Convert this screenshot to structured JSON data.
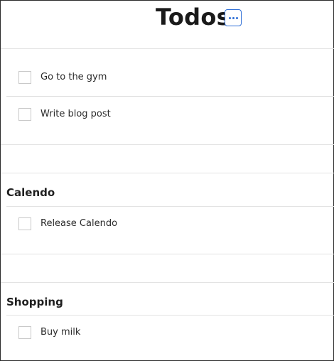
{
  "header": {
    "title": "Todos",
    "more_button_icon": "ellipsis-icon",
    "accent_color": "#2f6fd6"
  },
  "groups": [
    {
      "title": "",
      "items": [
        {
          "label": "Go to the gym",
          "checked": false
        },
        {
          "label": "Write blog post",
          "checked": false
        }
      ]
    },
    {
      "title": "Calendo",
      "items": [
        {
          "label": "Release Calendo",
          "checked": false
        }
      ]
    },
    {
      "title": "Shopping",
      "items": [
        {
          "label": "Buy milk",
          "checked": false
        }
      ]
    }
  ]
}
